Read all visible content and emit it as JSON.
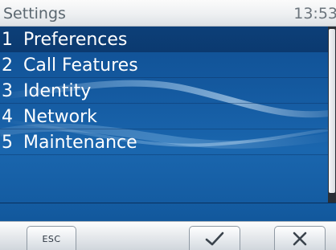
{
  "status_bar": {
    "title": "Settings",
    "time": "13:53"
  },
  "menu": {
    "items": [
      {
        "number": "1",
        "label": "Preferences",
        "selected": true
      },
      {
        "number": "2",
        "label": "Call Features",
        "selected": false
      },
      {
        "number": "3",
        "label": "Identity",
        "selected": false
      },
      {
        "number": "4",
        "label": "Network",
        "selected": false
      },
      {
        "number": "5",
        "label": "Maintenance",
        "selected": false
      }
    ]
  },
  "softkeys": {
    "esc_label": "ESC",
    "ok_icon": "checkmark-icon",
    "cancel_icon": "close-icon"
  },
  "colors": {
    "background_blue": "#14599f",
    "selected_row": "#0b3a70",
    "text": "#ffffff"
  }
}
